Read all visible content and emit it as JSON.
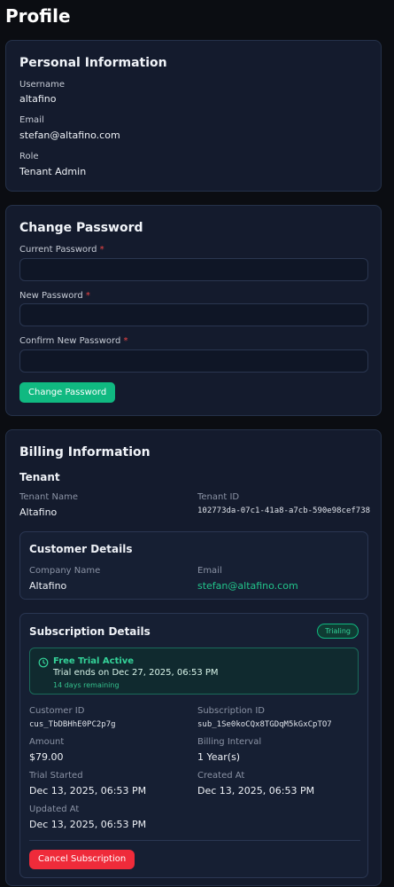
{
  "page": {
    "title": "Profile"
  },
  "personal": {
    "title": "Personal Information",
    "username_label": "Username",
    "username": "altafino",
    "email_label": "Email",
    "email": "stefan@altafino.com",
    "role_label": "Role",
    "role": "Tenant Admin"
  },
  "password": {
    "title": "Change Password",
    "current_label": "Current Password",
    "new_label": "New Password",
    "confirm_label": "Confirm New Password",
    "required_mark": "*",
    "current_value": "",
    "new_value": "",
    "confirm_value": "",
    "submit_label": "Change Password"
  },
  "billing": {
    "title": "Billing Information",
    "tenant_heading": "Tenant",
    "tenant_name_label": "Tenant Name",
    "tenant_name": "Altafino",
    "tenant_id_label": "Tenant ID",
    "tenant_id": "102773da-07c1-41a8-a7cb-590e98cef738",
    "customer": {
      "title": "Customer Details",
      "company_label": "Company Name",
      "company": "Altafino",
      "email_label": "Email",
      "email": "stefan@altafino.com"
    },
    "subscription": {
      "title": "Subscription Details",
      "status_badge": "Trialing",
      "trial_title": "Free Trial Active",
      "trial_ends": "Trial ends on Dec 27, 2025, 06:53 PM",
      "trial_remaining": "14 days remaining",
      "customer_id_label": "Customer ID",
      "customer_id": "cus_TbDBHhE0PC2p7g",
      "subscription_id_label": "Subscription ID",
      "subscription_id": "sub_1Se0koCQx8TGDqM5kGxCpTO7",
      "amount_label": "Amount",
      "amount": "$79.00",
      "interval_label": "Billing Interval",
      "interval": "1 Year(s)",
      "trial_started_label": "Trial Started",
      "trial_started": "Dec 13, 2025, 06:53 PM",
      "created_label": "Created At",
      "created": "Dec 13, 2025, 06:53 PM",
      "updated_label": "Updated At",
      "updated": "Dec 13, 2025, 06:53 PM",
      "cancel_label": "Cancel Subscription"
    }
  },
  "colors": {
    "background": "#0b0d12",
    "card": "#141b2d",
    "accent_green": "#10b981",
    "danger_red": "#ef2b3a"
  },
  "icons": {
    "trial": "clock-icon"
  }
}
